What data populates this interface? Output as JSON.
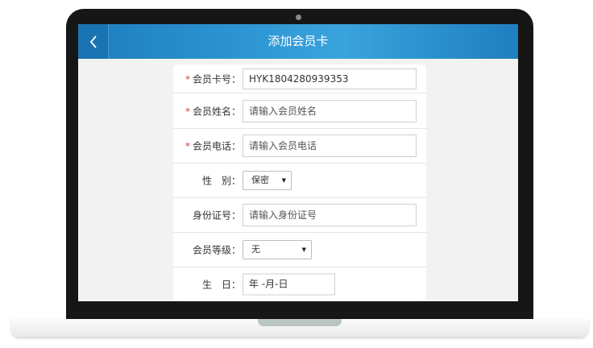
{
  "header": {
    "title": "添加会员卡",
    "back_icon": "chevron-left-icon"
  },
  "form": {
    "card_number": {
      "label": "会员卡号：",
      "required": true,
      "value": "HYK1804280939353"
    },
    "name": {
      "label": "会员姓名：",
      "required": true,
      "placeholder": "请输入会员姓名"
    },
    "phone": {
      "label": "会员电话：",
      "required": true,
      "placeholder": "请输入会员电话"
    },
    "gender": {
      "label": "性　别：",
      "required": false,
      "value": "保密"
    },
    "id_number": {
      "label": "身份证号：",
      "required": false,
      "placeholder": "请输入身份证号"
    },
    "level": {
      "label": "会员等级：",
      "required": false,
      "value": "无"
    },
    "birthday": {
      "label": "生　日：",
      "required": false,
      "value": "年 -月-日"
    }
  },
  "colors": {
    "header_bg": "#2f97d4",
    "required_mark": "#e23b3b"
  },
  "required_mark": "*"
}
